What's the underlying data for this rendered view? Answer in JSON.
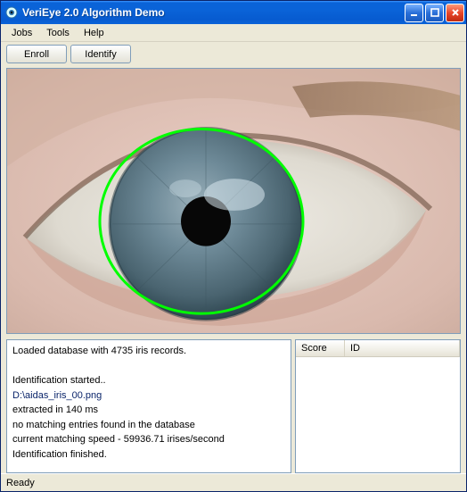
{
  "window": {
    "title": "VeriEye 2.0 Algorithm Demo"
  },
  "menubar": {
    "items": [
      "Jobs",
      "Tools",
      "Help"
    ]
  },
  "toolbar": {
    "enroll_label": "Enroll",
    "identify_label": "Identify"
  },
  "log": {
    "line0": "Loaded database with 4735 iris records.",
    "line_blank1": "",
    "line1": "Identification started..",
    "line2_link": "D:\\aidas_iris_00.png",
    "line3": "extracted in 140 ms",
    "line4": "no matching entries found in the database",
    "line5": "current matching speed - 59936.71 irises/second",
    "line6": "Identification finished."
  },
  "list": {
    "col_score": "Score",
    "col_id": "ID"
  },
  "statusbar": {
    "text": "Ready"
  },
  "iris_overlay": {
    "color": "#00ff00"
  }
}
